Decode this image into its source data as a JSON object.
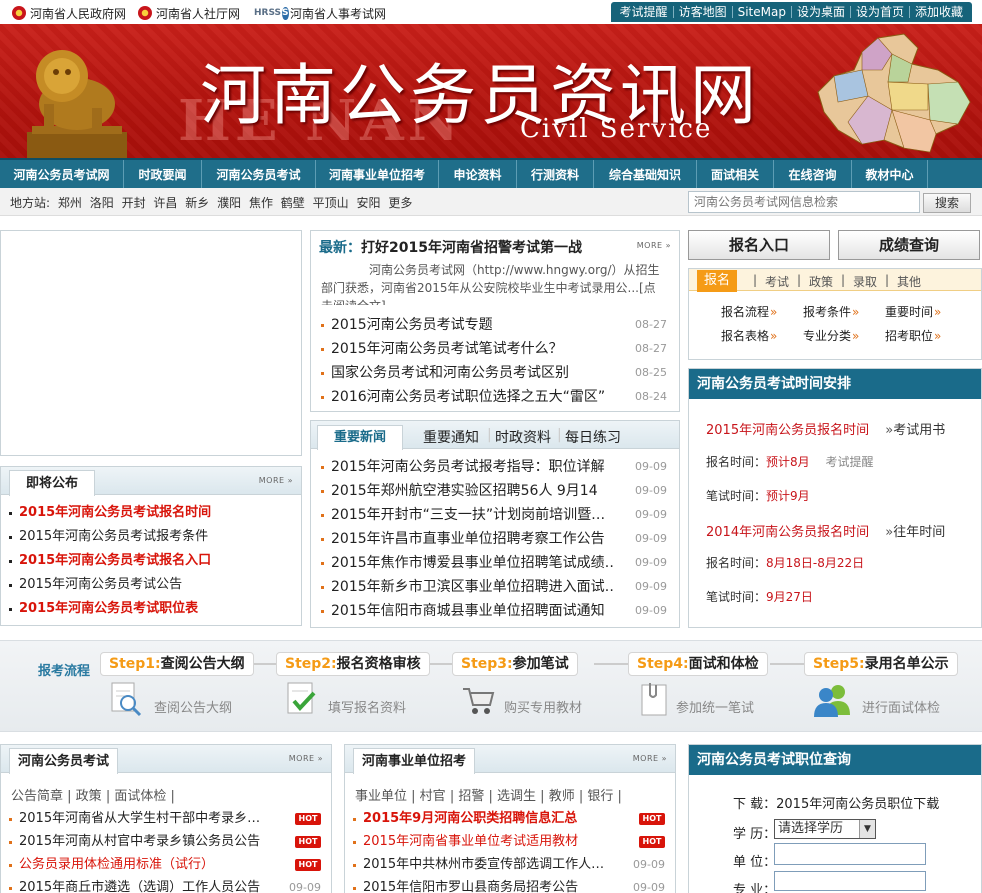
{
  "top": {
    "gov_links": [
      "河南省人民政府网",
      "河南省人社厅网",
      "河南省人事考试网"
    ],
    "hrss_logo": "HRSS",
    "quick_links": [
      "考试提醒",
      "访客地图",
      "SiteMap",
      "设为桌面",
      "设为首页",
      "添加收藏"
    ]
  },
  "banner": {
    "title": "河南公务员资讯网",
    "subtitle": "Civil Service",
    "watermark": "HE NAN"
  },
  "nav": {
    "items": [
      "河南公务员考试网",
      "时政要闻",
      "河南公务员考试",
      "河南事业单位招考",
      "申论资料",
      "行测资料",
      "综合基础知识",
      "面试相关",
      "在线咨询",
      "教材中心"
    ]
  },
  "subbar": {
    "label": "地方站:",
    "cities": [
      "郑州",
      "洛阳",
      "开封",
      "许昌",
      "新乡",
      "濮阳",
      "焦作",
      "鹤壁",
      "平顶山",
      "安阳",
      "更多"
    ],
    "search_placeholder": "河南公务员考试网信息检索",
    "search_button": "搜索"
  },
  "headline": {
    "label": "最新：",
    "title": "打好2015年河南省招警考试第一战",
    "more": "MORE",
    "summary": "河南公务员考试网（http://www.hngwy.org/）从招生部门获悉，河南省2015年从公安院校毕业生中考试录用公...[点击阅读全文]",
    "items": [
      {
        "title": "2015河南公务员考试专题",
        "date": "08-27"
      },
      {
        "title": "2015年河南公务员考试笔试考什么？",
        "date": "08-27"
      },
      {
        "title": "国家公务员考试和河南公务员考试区别",
        "date": "08-25"
      },
      {
        "title": "2016河南公务员考试职位选择之五大“雷区”",
        "date": "08-24"
      }
    ]
  },
  "news_tabs": {
    "active": "重要新闻",
    "others": [
      "重要通知",
      "时政资料",
      "每日练习"
    ],
    "items": [
      {
        "title": "2015年河南公务员考试报考指导：职位详解",
        "date": "09-09"
      },
      {
        "title": "2015年郑州航空港实验区招聘56人 9月14",
        "date": "09-09"
      },
      {
        "title": "2015年开封市“三支一扶”计划岗前培训暨…",
        "date": "09-09"
      },
      {
        "title": "2015年许昌市直事业单位招聘考察工作公告",
        "date": "09-09"
      },
      {
        "title": "2015年焦作市博爱县事业单位招聘笔试成绩…",
        "date": "09-09"
      },
      {
        "title": "2015年新乡市卫滨区事业单位招聘进入面试…",
        "date": "09-09"
      },
      {
        "title": "2015年信阳市商城县事业单位招聘面试通知",
        "date": "09-09"
      }
    ]
  },
  "notice": {
    "title": "即将公布",
    "more": "MORE",
    "items": [
      {
        "title": "2015年河南公务员考试报名时间",
        "red": true
      },
      {
        "title": "2015年河南公务员考试报考条件",
        "red": false
      },
      {
        "title": "2015年河南公务员考试报名入口",
        "red": true
      },
      {
        "title": "2015年河南公务员考试公告",
        "red": false
      },
      {
        "title": "2015年河南公务员考试职位表",
        "red": true
      }
    ]
  },
  "right": {
    "btn_register": "报名入口",
    "btn_score": "成绩查询",
    "reg_tabs": [
      "报名",
      "考试",
      "政策",
      "录取",
      "其他"
    ],
    "reg_links": [
      "报名流程",
      "报考条件",
      "重要时间",
      "报名表格",
      "专业分类",
      "招考职位"
    ]
  },
  "schedule": {
    "title": "河南公务员考试时间安排",
    "y2015": {
      "head": "2015年河南公务员报名时间",
      "link": "考试用书",
      "reg_label": "报名时间：",
      "reg_value": "预计8月",
      "reminder": "考试提醒",
      "exam_label": "笔试时间：",
      "exam_value": "预计9月"
    },
    "y2014": {
      "head": "2014年河南公务员报名时间",
      "link": "往年时间",
      "reg_label": "报名时间：",
      "reg_value": "8月18日-8月22日",
      "exam_label": "笔试时间：",
      "exam_value": "9月27日"
    }
  },
  "process": {
    "label": "报考流程",
    "steps": [
      {
        "n": "Step1:",
        "t": "查阅公告大纲",
        "icon": "magnifier-doc-icon",
        "desc": "查阅公告大纲"
      },
      {
        "n": "Step2:",
        "t": "报名资格审核",
        "icon": "check-doc-icon",
        "desc": "填写报名资料"
      },
      {
        "n": "Step3:",
        "t": "参加笔试",
        "icon": "cart-icon",
        "desc": "购买专用教材"
      },
      {
        "n": "Step4:",
        "t": "面试和体检",
        "icon": "clip-doc-icon",
        "desc": "参加统一笔试"
      },
      {
        "n": "Step5:",
        "t": "录用名单公示",
        "icon": "users-icon",
        "desc": "进行面试体检"
      }
    ]
  },
  "gwy_box": {
    "title": "河南公务员考试",
    "more": "MORE",
    "sublinks": [
      "公告简章",
      "政策",
      "面试体检"
    ],
    "items": [
      {
        "title": "2015年河南省从大学生村干部中考录乡…",
        "tag": "HOT",
        "style": "normal"
      },
      {
        "title": "2015年河南从村官中考录乡镇公务员公告",
        "tag": "HOT",
        "style": "normal"
      },
      {
        "title": "公务员录用体检通用标准（试行）",
        "tag": "HOT",
        "style": "red"
      },
      {
        "title": "2015年商丘市遴选（选调）工作人员公告",
        "date": "09-09",
        "style": "normal"
      }
    ]
  },
  "sydw_box": {
    "title": "河南事业单位招考",
    "more": "MORE",
    "sublinks": [
      "事业单位",
      "村官",
      "招警",
      "选调生",
      "教师",
      "银行"
    ],
    "items": [
      {
        "title": "2015年9月河南公职类招聘信息汇总",
        "tag": "HOT",
        "style": "redb"
      },
      {
        "title": "2015年河南省事业单位考试适用教材",
        "tag": "HOT",
        "style": "red"
      },
      {
        "title": "2015年中共林州市委宣传部选调工作人…",
        "date": "09-09",
        "style": "normal"
      },
      {
        "title": "2015年信阳市罗山县商务局招考公告",
        "date": "09-09",
        "style": "normal"
      }
    ]
  },
  "position_query": {
    "title": "河南公务员考试职位查询",
    "download_label": "下 载：",
    "download_link": "2015年河南公务员职位下载",
    "edu_label": "学 历：",
    "edu_selected": "请选择学历",
    "unit_label": "单 位：",
    "major_label": "专 业："
  }
}
